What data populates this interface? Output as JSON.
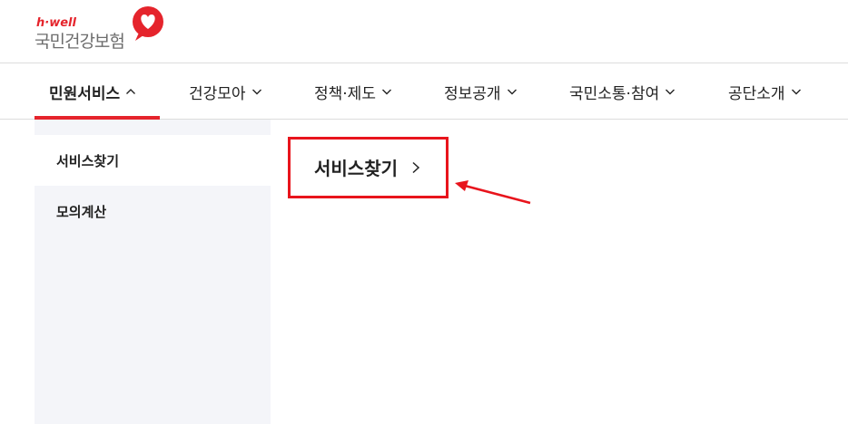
{
  "logo": {
    "tagline": "h·well",
    "name": "국민건강보험",
    "brand_color": "#e5242c"
  },
  "gnb": {
    "items": [
      {
        "label": "민원서비스",
        "icon": "chevron-up-icon",
        "active": true
      },
      {
        "label": "건강모아",
        "icon": "chevron-down-icon"
      },
      {
        "label": "정책·제도",
        "icon": "chevron-down-icon"
      },
      {
        "label": "정보공개",
        "icon": "chevron-down-icon"
      },
      {
        "label": "국민소통·참여",
        "icon": "chevron-down-icon"
      },
      {
        "label": "공단소개",
        "icon": "chevron-down-icon"
      }
    ]
  },
  "submenu": {
    "items": [
      {
        "label": "서비스찾기",
        "selected": true
      },
      {
        "label": "모의계산",
        "selected": false
      }
    ]
  },
  "main": {
    "link_label": "서비스찾기",
    "link_icon": "chevron-right-icon"
  },
  "annotation": {
    "box_color": "#e8141c",
    "arrow_color": "#e8141c"
  }
}
